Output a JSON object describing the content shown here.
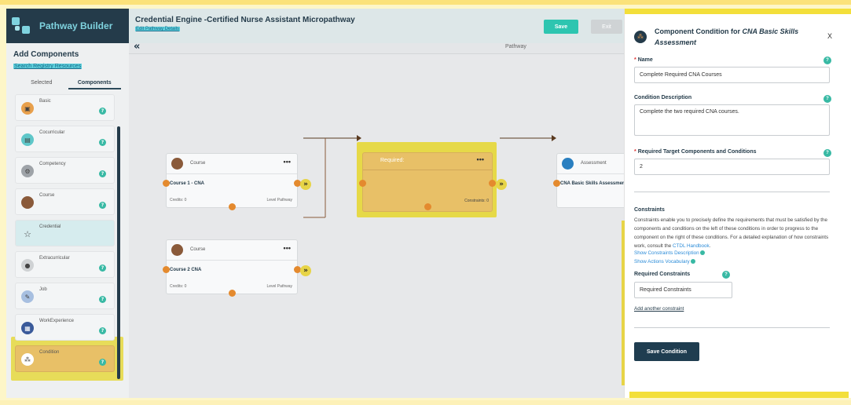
{
  "app": {
    "name": "Pathway Builder"
  },
  "sidebar": {
    "heading": "Add Components",
    "search_link": "Search Registry Resources",
    "tabs": [
      {
        "label": "Selected"
      },
      {
        "label": "Components"
      }
    ],
    "items": [
      {
        "label": "Basic",
        "icon": "box-icon"
      },
      {
        "label": "Cocurricular",
        "icon": "cocurricular-icon"
      },
      {
        "label": "Competency",
        "icon": "competency-icon"
      },
      {
        "label": "Course",
        "icon": "course-icon"
      },
      {
        "label": "Credential",
        "icon": "star-icon"
      },
      {
        "label": "Extracurricular",
        "icon": "extracurricular-icon"
      },
      {
        "label": "Job",
        "icon": "job-icon"
      },
      {
        "label": "WorkExperience",
        "icon": "work-experience-icon"
      },
      {
        "label": "Condition",
        "icon": "condition-icon"
      }
    ],
    "help_glyph": "?"
  },
  "header": {
    "title": "Credential Engine -Certified Nurse Assistant Micropathway",
    "edit_link": "Edit Pathway Details",
    "save_label": "Save",
    "exit_label": "Exit",
    "canvas_label": "Pathway",
    "collapse_glyph": "«"
  },
  "canvas": {
    "course1": {
      "type": "Course",
      "name": "Course 1 - CNA",
      "credits": "Credits: 0",
      "level": "Level Pathway"
    },
    "course2": {
      "type": "Course",
      "name": "Course 2 CNA",
      "credits": "Credits: 0",
      "level": "Level Pathway"
    },
    "condition": {
      "label": "Required:",
      "constraints": "Constraints: 0"
    },
    "assessment": {
      "type": "Assessment",
      "name": "CNA Basic Skills Assessment"
    },
    "menu_glyph": "•••",
    "chevron_glyph": "»"
  },
  "panel": {
    "title_prefix": "Component Condition for ",
    "title_target": "CNA Basic Skills Assessment",
    "close_label": "X",
    "name_label": "Name",
    "name_value": "Complete Required CNA Courses",
    "desc_label": "Condition Description",
    "desc_value": "Complete the two required CNA courses.",
    "target_label": "Required Target Components and Conditions",
    "target_value": "2",
    "required_marker": "*",
    "constraints_heading": "Constraints",
    "constraints_text": "Constraints enable you to precisely define the requirements that must be satisfied by the components and conditions on the left of these conditions in order to progress to the component on the right of these conditions. For a detailed explanation of how constraints work, consult the ",
    "handbook_link": "CTDL Handbook",
    "show_desc_link": "Show Constraints Description",
    "show_vocab_link": "Show Actions Vocabulary",
    "req_constraints_label": "Required Constraints",
    "req_constraints_placeholder": "Required Constraints",
    "add_constraint_link": "Add another constraint",
    "save_condition_label": "Save Condition"
  },
  "colors": {
    "brand": "#243b4a",
    "accent": "#2dc5b0",
    "highlight": "#e6d948",
    "port": "#e48a2e"
  }
}
